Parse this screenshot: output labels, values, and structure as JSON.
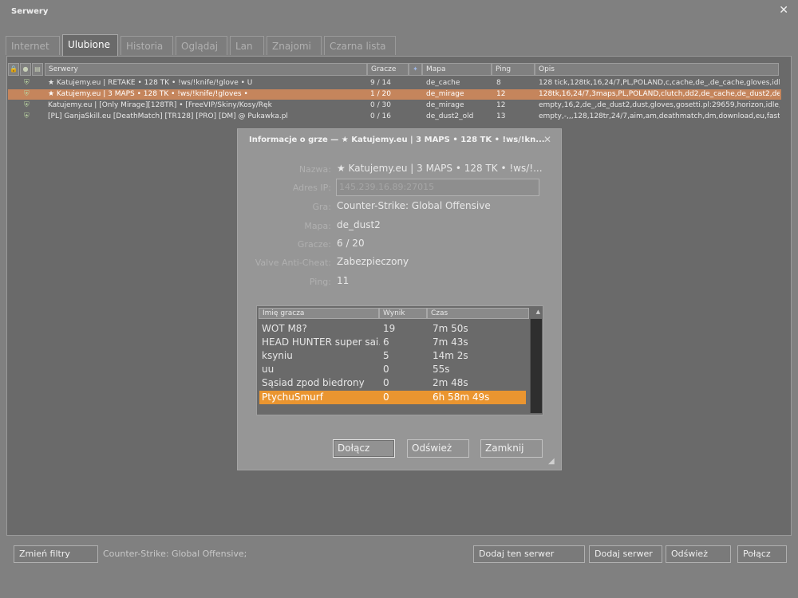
{
  "window": {
    "title": "Serwery",
    "close_glyph": "✕"
  },
  "tabs": [
    {
      "label": "Internet"
    },
    {
      "label": "Ulubione",
      "active": true
    },
    {
      "label": "Historia"
    },
    {
      "label": "Oglądaj"
    },
    {
      "label": "Lan"
    },
    {
      "label": "Znajomi"
    },
    {
      "label": "Czarna lista"
    }
  ],
  "columns": {
    "lock_icon": "lock-icon",
    "vac_icon": "shield-icon",
    "replay_icon": "replay-icon",
    "servers": "Serwery",
    "players": "Gracze",
    "bots_icon": "bot-icon",
    "map": "Mapa",
    "ping": "Ping",
    "description": "Opis"
  },
  "servers": [
    {
      "name": "★ Katujemy.eu | RETAKE • 128 TK • !ws/!knife/!glove • U",
      "players": "9 / 14",
      "map": "de_cache",
      "ping": "8",
      "desc": "128 tick,128tk,16,24/7,PL,POLAND,c,cache,de_,de_cache,gloves,idl...",
      "secure": true,
      "selected": false
    },
    {
      "name": "★ Katujemy.eu | 3 MAPS • 128 TK • !ws/!knife/!gloves •",
      "players": "1 / 20",
      "map": "de_mirage",
      "ping": "12",
      "desc": "128tk,16,24/7,3maps,PL,POLAND,clutch,dd2,de_cache,de_dust2,de...",
      "secure": true,
      "selected": true
    },
    {
      "name": "Katujemy.eu | [Only Mirage][128TR] • [FreeVIP/Skiny/Kosy/Ręk",
      "players": "0 / 30",
      "map": "de_mirage",
      "ping": "12",
      "desc": "empty,16,2,de_,de_dust2,dust,gloves,gosetti.pl:29659,horizon,idle,...",
      "secure": true,
      "selected": false
    },
    {
      "name": "[PL] GanjaSkill.eu [DeathMatch] [TR128] [PRO] [DM] @ Pukawka.pl",
      "players": "0 / 16",
      "map": "de_dust2_old",
      "ping": "13",
      "desc": "empty,-,,,128,128tr,24/7,aim,am,deathmatch,dm,download,eu,fast,...",
      "secure": true,
      "selected": false
    }
  ],
  "bottom": {
    "change_filters": "Zmień filtry",
    "status": "Counter-Strike: Global Offensive;",
    "add_this_server": "Dodaj ten serwer",
    "add_server": "Dodaj serwer",
    "refresh": "Odśwież",
    "connect": "Połącz"
  },
  "dialog": {
    "title": "Informacje o grze — ★ Katujemy.eu | 3 MAPS • 128 TK • !ws/!kn...",
    "close_glyph": "✕",
    "labels": {
      "name": "Nazwa:",
      "ip": "Adres IP:",
      "game": "Gra:",
      "map": "Mapa:",
      "players": "Gracze:",
      "vac": "Valve Anti-Cheat:",
      "ping": "Ping:"
    },
    "values": {
      "name": "★ Katujemy.eu | 3 MAPS • 128 TK • !ws/!...",
      "ip": "145.239.16.89:27015",
      "game": "Counter-Strike: Global Offensive",
      "map": "de_dust2",
      "players": "6 / 20",
      "vac": "Zabezpieczony",
      "ping": "11"
    },
    "player_columns": {
      "name": "Imię gracza",
      "score": "Wynik",
      "time": "Czas"
    },
    "players": [
      {
        "name": "WOT M8?",
        "score": "19",
        "time": "7m 50s",
        "selected": false
      },
      {
        "name": "HEAD HUNTER super sai...",
        "score": "6",
        "time": "7m 43s",
        "selected": false
      },
      {
        "name": "ksyniu",
        "score": "5",
        "time": "14m 2s",
        "selected": false
      },
      {
        "name": "uu",
        "score": "0",
        "time": "55s",
        "selected": false
      },
      {
        "name": "Sąsiad zpod biedrony",
        "score": "0",
        "time": "2m 48s",
        "selected": false
      },
      {
        "name": "PtychuSmurf",
        "score": "0",
        "time": "6h 58m 49s",
        "selected": true
      }
    ],
    "buttons": {
      "join": "Dołącz",
      "refresh": "Odśwież",
      "close": "Zamknij"
    }
  },
  "colors": {
    "selected_row": "#c5855c",
    "selected_player": "#ea9530",
    "secure_icon": "#b6cf9e"
  }
}
